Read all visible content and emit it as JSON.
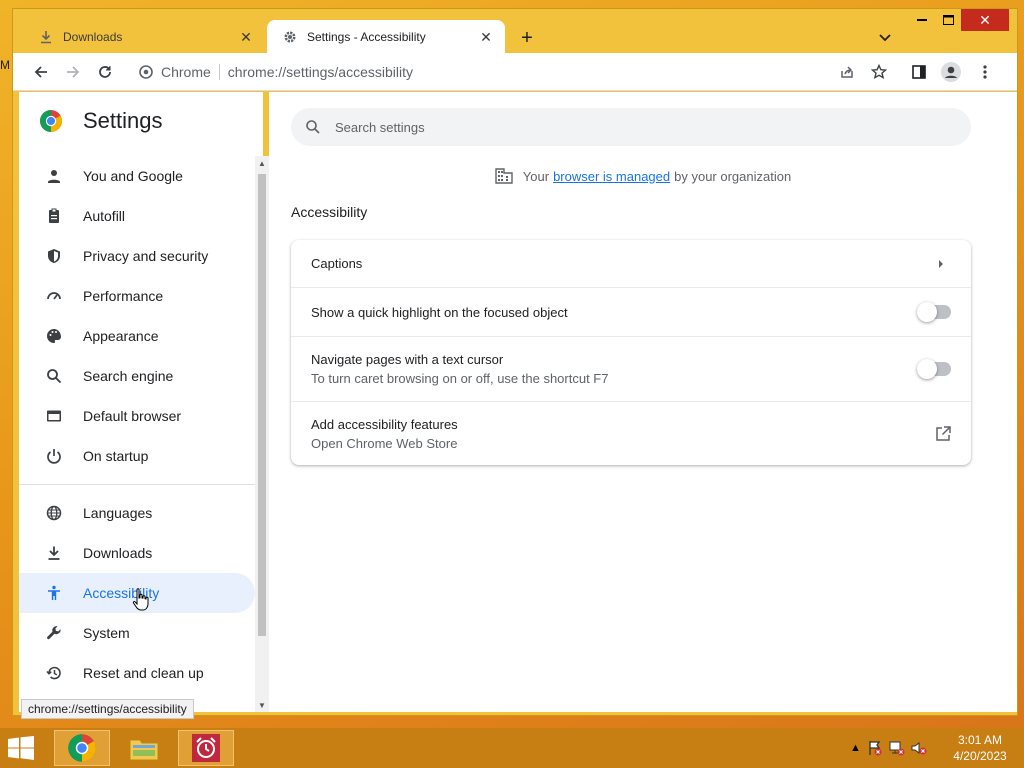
{
  "tabs": [
    {
      "title": "Downloads",
      "icon": "download-icon",
      "active": false
    },
    {
      "title": "Settings - Accessibility",
      "icon": "gear-icon",
      "active": true
    }
  ],
  "toolbar": {
    "site_label": "Chrome",
    "url": "chrome://settings/accessibility"
  },
  "sidebar": {
    "title": "Settings",
    "items": [
      {
        "label": "You and Google",
        "icon": "person-icon"
      },
      {
        "label": "Autofill",
        "icon": "clipboard-icon"
      },
      {
        "label": "Privacy and security",
        "icon": "shield-icon"
      },
      {
        "label": "Performance",
        "icon": "gauge-icon"
      },
      {
        "label": "Appearance",
        "icon": "palette-icon"
      },
      {
        "label": "Search engine",
        "icon": "search-icon"
      },
      {
        "label": "Default browser",
        "icon": "browser-window-icon"
      },
      {
        "label": "On startup",
        "icon": "power-icon"
      },
      {
        "label": "Languages",
        "icon": "globe-icon"
      },
      {
        "label": "Downloads",
        "icon": "download-icon"
      },
      {
        "label": "Accessibility",
        "icon": "accessibility-icon",
        "active": true
      },
      {
        "label": "System",
        "icon": "wrench-icon"
      },
      {
        "label": "Reset and clean up",
        "icon": "history-icon"
      }
    ]
  },
  "status_url": "chrome://settings/accessibility",
  "main": {
    "search_placeholder": "Search settings",
    "managed_prefix": "Your",
    "managed_link": "browser is managed",
    "managed_suffix": "by your organization",
    "section_title": "Accessibility",
    "rows": [
      {
        "label": "Captions",
        "sub": ""
      },
      {
        "label": "Show a quick highlight on the focused object",
        "sub": "",
        "toggle": false
      },
      {
        "label": "Navigate pages with a text cursor",
        "sub": "To turn caret browsing on or off, use the shortcut F7",
        "toggle": false
      },
      {
        "label": "Add accessibility features",
        "sub": "Open Chrome Web Store"
      }
    ]
  },
  "taskbar": {
    "time": "3:01 AM",
    "date": "4/20/2023"
  },
  "colors": {
    "accent": "#1a73e8",
    "active_bg": "#e8f0fe",
    "window_frame": "#f2c23c",
    "close_button": "#c42b1c",
    "taskbar": "#c77e13"
  }
}
